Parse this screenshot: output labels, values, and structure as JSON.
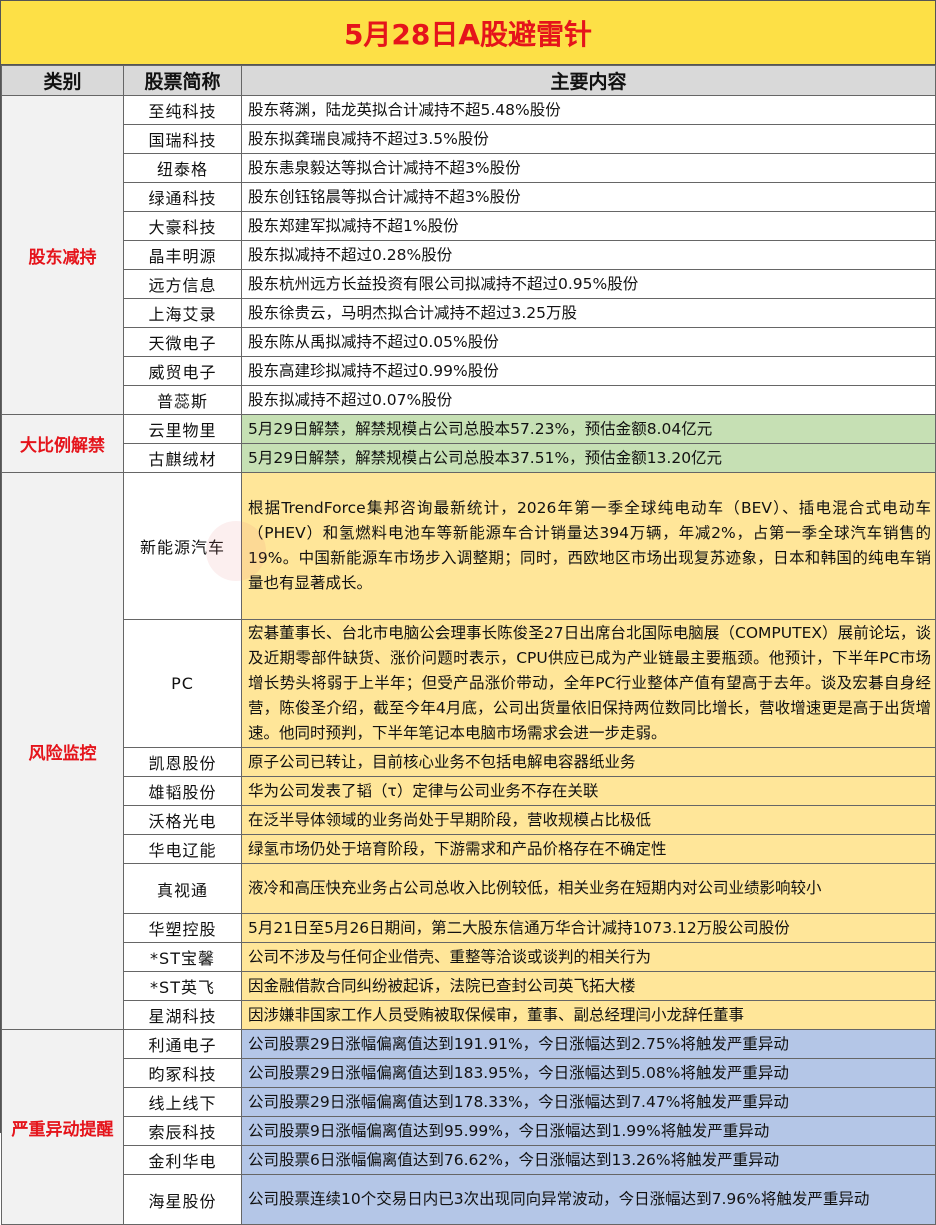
{
  "title": "5月28日A股避雷针",
  "headers": {
    "category": "类别",
    "name": "股票简称",
    "content": "主要内容"
  },
  "groups": [
    {
      "category": "股东减持",
      "color": "#ffffff",
      "rows": [
        {
          "name": "至纯科技",
          "content": "股东蒋渊，陆龙英拟合计减持不超5.48%股份"
        },
        {
          "name": "国瑞科技",
          "content": "股东拟龚瑞良减持不超过3.5%股份"
        },
        {
          "name": "纽泰格",
          "content": "股东恚泉毅达等拟合计减持不超3%股份"
        },
        {
          "name": "绿通科技",
          "content": "股东创钰铭晨等拟合计减持不超3%股份"
        },
        {
          "name": "大豪科技",
          "content": "股东郑建军拟减持不超1%股份"
        },
        {
          "name": "晶丰明源",
          "content": "股东拟减持不超过0.28%股份"
        },
        {
          "name": "远方信息",
          "content": "股东杭州远方长益投资有限公司拟减持不超过0.95%股份"
        },
        {
          "name": "上海艾录",
          "content": "股东徐贵云，马明杰拟合计减持不超过3.25万股"
        },
        {
          "name": "天微电子",
          "content": "股东陈从禹拟减持不超过0.05%股份"
        },
        {
          "name": "威贸电子",
          "content": "股东高建珍拟减持不超过0.99%股份"
        },
        {
          "name": "普蕊斯",
          "content": "股东拟减持不超过0.07%股份"
        }
      ]
    },
    {
      "category": "大比例解禁",
      "color": "#c6e0b4",
      "rows": [
        {
          "name": "云里物里",
          "content": "5月29日解禁，解禁规模占公司总股本57.23%，预估金额8.04亿元"
        },
        {
          "name": "古麒绒材",
          "content": "5月29日解禁，解禁规模占公司总股本37.51%，预估金额13.20亿元"
        }
      ]
    },
    {
      "category": "风险监控",
      "color": "#ffe699",
      "rows": [
        {
          "name": "新能源汽车",
          "content": "根据TrendForce集邦咨询最新统计，2026年第一季全球纯电动车（BEV）、插电混合式电动车（PHEV）和氢燃料电池车等新能源车合计销量达394万辆，年减2%，占第一季全球汽车销售的19%。中国新能源车市场步入调整期；同时，西欧地区市场出现复苏迹象，日本和韩国的纯电车销量也有显著成长。"
        },
        {
          "name": "PC",
          "content": "宏碁董事长、台北市电脑公会理事长陈俊圣27日出席台北国际电脑展（COMPUTEX）展前论坛，谈及近期零部件缺货、涨价问题时表示，CPU供应已成为产业链最主要瓶颈。他预计，下半年PC市场增长势头将弱于上半年；但受产品涨价带动，全年PC行业整体产值有望高于去年。谈及宏碁自身经营，陈俊圣介绍，截至今年4月底，公司出货量依旧保持两位数同比增长，营收增速更是高于出货增速。他同时预判，下半年笔记本电脑市场需求会进一步走弱。"
        },
        {
          "name": "凯恩股份",
          "content": "原子公司已转让，目前核心业务不包括电解电容器纸业务"
        },
        {
          "name": "雄韬股份",
          "content": "华为公司发表了韬（τ）定律与公司业务不存在关联"
        },
        {
          "name": "沃格光电",
          "content": "在泛半导体领域的业务尚处于早期阶段，营收规模占比极低"
        },
        {
          "name": "华电辽能",
          "content": "绿氢市场仍处于培育阶段，下游需求和产品价格存在不确定性"
        },
        {
          "name": "真视通",
          "content": "液冷和高压快充业务占公司总收入比例较低，相关业务在短期内对公司业绩影响较小"
        },
        {
          "name": "华塑控股",
          "content": "5月21日至5月26日期间，第二大股东信通万华合计减持1073.12万股公司股份"
        },
        {
          "name": "*ST宝馨",
          "content": "公司不涉及与任何企业借壳、重整等洽谈或谈判的相关行为"
        },
        {
          "name": "*ST英飞",
          "content": "因金融借款合同纠纷被起诉，法院已查封公司英飞拓大楼"
        },
        {
          "name": "星湖科技",
          "content": "因涉嫌非国家工作人员受贿被取保候审，董事、副总经理闫小龙辞任董事"
        }
      ]
    },
    {
      "category": "严重异动提醒",
      "color": "#b4c6e7",
      "rows": [
        {
          "name": "利通电子",
          "content": "公司股票29日涨幅偏离值达到191.91%，今日涨幅达到2.75%将触发严重异动"
        },
        {
          "name": "昀冢科技",
          "content": "公司股票29日涨幅偏离值达到183.95%，今日涨幅达到5.08%将触发严重异动"
        },
        {
          "name": "线上线下",
          "content": "公司股票29日涨幅偏离值达到178.33%，今日涨幅达到7.47%将触发严重异动"
        },
        {
          "name": "索辰科技",
          "content": "公司股票9日涨幅偏离值达到95.99%，今日涨幅达到1.99%将触发严重异动"
        },
        {
          "name": "金利华电",
          "content": "公司股票6日涨幅偏离值达到76.62%，今日涨幅达到13.26%将触发严重异动"
        },
        {
          "name": "海星股份",
          "content": "公司股票连续10个交易日内已3次出现同向异常波动，今日涨幅达到7.96%将触发严重异动"
        }
      ]
    }
  ]
}
